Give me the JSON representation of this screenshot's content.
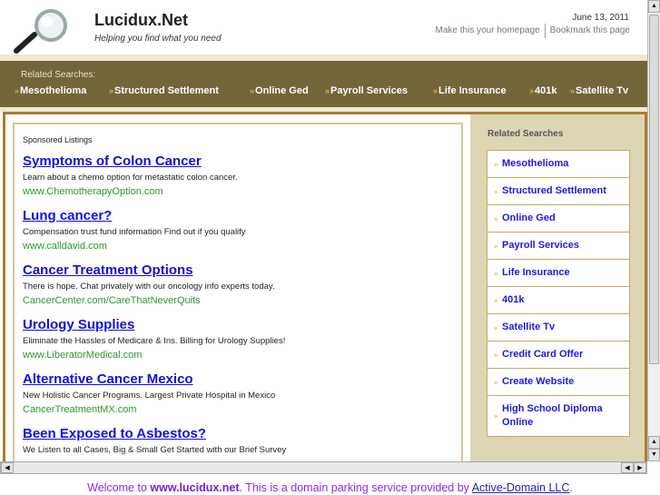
{
  "header": {
    "title": "Lucidux.Net",
    "tagline": "Helping you find what you need",
    "date": "June 13, 2011",
    "homepage_link": "Make this your homepage",
    "bookmark_link": "Bookmark this page"
  },
  "nav": {
    "label": "Related Searches:",
    "items": [
      "Mesothelioma",
      "Structured Settlement",
      "Online Ged",
      "Payroll Services",
      "Life Insurance",
      "401k",
      "Satellite Tv"
    ]
  },
  "main": {
    "sponsored_label": "Sponsored Listings",
    "ads": [
      {
        "title": "Symptoms of Colon Cancer",
        "desc": "Learn about a chemo option for metastatic colon cancer.",
        "url": "www.ChemotherapyOption.com"
      },
      {
        "title": "Lung cancer?",
        "desc": "Compensation trust fund information Find out if you qualify",
        "url": "www.calldavid.com"
      },
      {
        "title": "Cancer Treatment Options",
        "desc": "There is hope. Chat privately with our oncology info experts today.",
        "url": "CancerCenter.com/CareThatNeverQuits"
      },
      {
        "title": "Urology Supplies",
        "desc": "Eliminate the Hassles of Medicare & Ins. Billing for Urology Supplies!",
        "url": "www.LiberatorMedical.com"
      },
      {
        "title": "Alternative Cancer Mexico",
        "desc": "New Holistic Cancer Programs. Largest Private Hospital in Mexico",
        "url": "CancerTreatmentMX.com"
      },
      {
        "title": "Been Exposed to Asbestos?",
        "desc": "We Listen to all Cases, Big & Small Get Started with our Brief Survey",
        "url": ""
      }
    ]
  },
  "sidebar": {
    "heading": "Related Searches",
    "items": [
      "Mesothelioma",
      "Structured Settlement",
      "Online Ged",
      "Payroll Services",
      "Life Insurance",
      "401k",
      "Satellite Tv",
      "Credit Card Offer",
      "Create Website",
      "High School Diploma Online"
    ]
  },
  "footer": {
    "prefix": "Welcome to ",
    "domain": "www.lucidux.net",
    "middle": ". This is a domain parking service provided by ",
    "provider": "Active-Domain LLC",
    "suffix": "."
  }
}
